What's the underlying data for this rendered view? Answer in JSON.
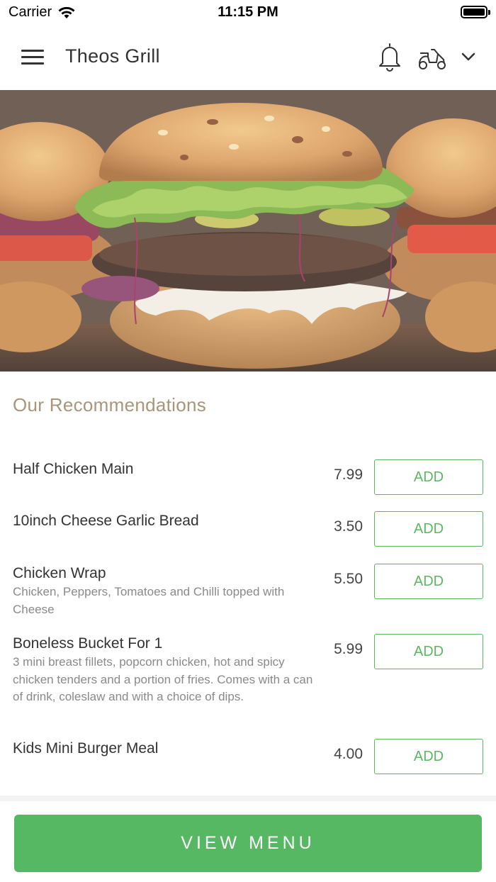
{
  "status_bar": {
    "carrier": "Carrier",
    "time": "11:15 PM"
  },
  "header": {
    "title": "Theos Grill",
    "icons": [
      "menu-icon",
      "bell-icon",
      "scooter-icon",
      "chevron-down-icon"
    ]
  },
  "hero": {
    "image": "burger-photo"
  },
  "recommendations": {
    "title": "Our Recommendations",
    "add_label": "ADD",
    "items": [
      {
        "name": "Half Chicken Main",
        "description": "",
        "price": "7.99"
      },
      {
        "name": "10inch Cheese Garlic Bread",
        "description": "",
        "price": "3.50"
      },
      {
        "name": "Chicken Wrap",
        "description": "Chicken, Peppers, Tomatoes and Chilli topped with Cheese",
        "price": "5.50"
      },
      {
        "name": "Boneless Bucket For 1",
        "description": "3 mini breast fillets, popcorn chicken, hot and spicy chicken tenders and a portion of fries. Comes with a can of drink, coleslaw and with a choice of dips.",
        "price": "5.99"
      },
      {
        "name": "Kids Mini Burger Meal",
        "description": "",
        "price": "4.00"
      }
    ]
  },
  "footer": {
    "view_menu_label": "VIEW MENU"
  },
  "colors": {
    "accent_green": "#56b862",
    "section_title": "#a8957a"
  }
}
